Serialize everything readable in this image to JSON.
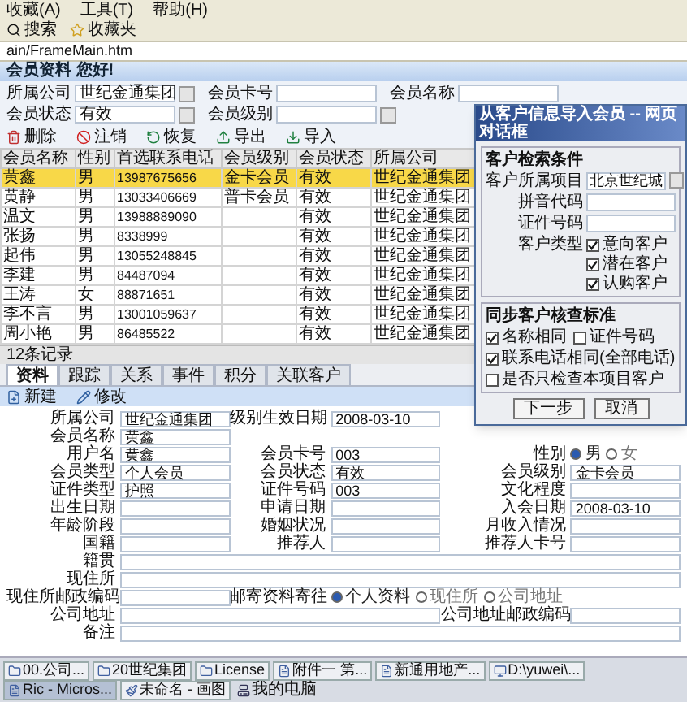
{
  "browser": {
    "menu": [
      "收藏(A)",
      "工具(T)",
      "帮助(H)"
    ],
    "toolbar": [
      "搜索",
      "收藏夹"
    ],
    "address": "ain/FrameMain.htm"
  },
  "header": {
    "title": "会员资料 您好!"
  },
  "search": [
    {
      "label": "所属公司",
      "value": "世纪金通集团",
      "kind": "lookup"
    },
    {
      "label": "会员卡号",
      "kind": "text"
    },
    {
      "label": "会员名称",
      "kind": "text"
    },
    {
      "label": "会员状态",
      "value": "有效",
      "kind": "lookup"
    },
    {
      "label": "会员级别",
      "kind": "lookup"
    }
  ],
  "actions": [
    {
      "label": "删除",
      "kind": "delete"
    },
    {
      "label": "注销",
      "kind": "cancel"
    },
    {
      "label": "恢复",
      "kind": "restore"
    },
    {
      "label": "导出",
      "kind": "export"
    },
    {
      "label": "导入",
      "kind": "import"
    }
  ],
  "table": {
    "columns": [
      "会员名称",
      "性别",
      "首选联系电话",
      "会员级别",
      "会员状态",
      "所属公司"
    ],
    "rows": [
      {
        "cells": [
          "黄鑫",
          "男",
          "13987675656",
          "金卡会员",
          "有效",
          "世纪金通集团"
        ],
        "selected": true
      },
      {
        "cells": [
          "黄静",
          "男",
          "13033406669",
          "普卡会员",
          "有效",
          "世纪金通集团"
        ],
        "selected": false
      },
      {
        "cells": [
          "温文",
          "男",
          "13988889090",
          "",
          "有效",
          "世纪金通集团"
        ],
        "selected": false
      },
      {
        "cells": [
          "张扬",
          "男",
          "8338999",
          "",
          "有效",
          "世纪金通集团"
        ],
        "selected": false
      },
      {
        "cells": [
          "起伟",
          "男",
          "13055248845",
          "",
          "有效",
          "世纪金通集团"
        ],
        "selected": false
      },
      {
        "cells": [
          "李建",
          "男",
          "84487094",
          "",
          "有效",
          "世纪金通集团"
        ],
        "selected": false
      },
      {
        "cells": [
          "王涛",
          "女",
          "88871651",
          "",
          "有效",
          "世纪金通集团"
        ],
        "selected": false
      },
      {
        "cells": [
          "李不言",
          "男",
          "13001059637",
          "",
          "有效",
          "世纪金通集团"
        ],
        "selected": false
      },
      {
        "cells": [
          "周小艳",
          "男",
          "86485522",
          "",
          "有效",
          "世纪金通集团"
        ],
        "selected": false
      }
    ]
  },
  "status": "12条记录",
  "tabs": [
    {
      "label": "资料",
      "selected": true
    },
    {
      "label": "跟踪",
      "selected": false
    },
    {
      "label": "关系",
      "selected": false
    },
    {
      "label": "事件",
      "selected": false
    },
    {
      "label": "积分",
      "selected": false
    },
    {
      "label": "关联客户",
      "selected": false
    }
  ],
  "form_toolbar": [
    {
      "label": "新建",
      "kind": "new"
    },
    {
      "label": "修改",
      "kind": "edit"
    }
  ],
  "form": [
    {
      "left": {
        "label": "所属公司",
        "value": "世纪金通集团"
      },
      "middle": {
        "label": "级别生效日期",
        "value": "2008-03-10"
      }
    },
    {
      "left": {
        "label": "会员名称",
        "value": "黄鑫"
      }
    },
    {
      "left": {
        "label": "用户名",
        "value": "黄鑫"
      },
      "middle": {
        "label": "会员卡号",
        "value": "003"
      },
      "right": {
        "label": "性别",
        "kind": "radio",
        "options": [
          {
            "label": "男",
            "selected": true
          },
          {
            "label": "女",
            "selected": false
          }
        ]
      }
    },
    {
      "left": {
        "label": "会员类型",
        "value": "个人会员"
      },
      "middle": {
        "label": "会员状态",
        "value": "有效"
      },
      "right": {
        "label": "会员级别",
        "value": "金卡会员"
      }
    },
    {
      "left": {
        "label": "证件类型",
        "value": "护照"
      },
      "middle": {
        "label": "证件号码",
        "value": "003"
      },
      "right": {
        "label": "文化程度"
      }
    },
    {
      "left": {
        "label": "出生日期"
      },
      "middle": {
        "label": "申请日期"
      },
      "right": {
        "label": "入会日期",
        "value": "2008-03-10"
      }
    },
    {
      "left": {
        "label": "年龄阶段"
      },
      "middle": {
        "label": "婚姻状况"
      },
      "right": {
        "label": "月收入情况"
      }
    },
    {
      "left": {
        "label": "国籍"
      },
      "middle": {
        "label": "推荐人"
      },
      "right": {
        "label": "推荐人卡号"
      }
    },
    {
      "left": {
        "label": "籍贯",
        "kind": "wide"
      }
    },
    {
      "left": {
        "label": "现住所",
        "kind": "wide"
      }
    },
    {
      "left": {
        "label": "现住所邮政编码"
      },
      "middle": {
        "label": "邮寄资料寄往",
        "kind": "radio",
        "options": [
          {
            "label": "个人资料",
            "selected": true
          },
          {
            "label": "现住所",
            "selected": false
          },
          {
            "label": "公司地址",
            "selected": false
          }
        ]
      }
    },
    {
      "left": {
        "label": "公司地址",
        "kind": "long"
      },
      "right": {
        "label": "公司地址邮政编码"
      }
    },
    {
      "left": {
        "label": "备注",
        "kind": "wide"
      }
    }
  ],
  "dialog": {
    "title": "从客户信息导入会员 -- 网页对话框",
    "criteria": {
      "title": "客户检索条件",
      "fields": [
        {
          "label": "客户所属项目",
          "value": "北京世纪城",
          "kind": "lookup"
        },
        {
          "label": "拼音代码",
          "kind": "text"
        },
        {
          "label": "证件号码",
          "kind": "text"
        },
        {
          "label": "客户类型",
          "kind": "checks",
          "options": [
            {
              "label": "意向客户",
              "checked": true
            },
            {
              "label": "潜在客户",
              "checked": true
            },
            {
              "label": "认购客户",
              "checked": true
            }
          ]
        }
      ]
    },
    "match": {
      "title": "同步客户核查标准",
      "options": [
        {
          "label": "名称相同",
          "checked": true
        },
        {
          "label": "证件号码",
          "checked": false
        },
        {
          "label": "联系电话相同(全部电话)",
          "checked": true
        },
        {
          "label": "是否只检查本项目客户",
          "checked": false
        }
      ]
    },
    "buttons": [
      "下一步",
      "取消"
    ]
  },
  "taskbar": {
    "items": [
      {
        "label": "00.公司...",
        "kind": "folder",
        "selected": false
      },
      {
        "label": "20世纪集团",
        "kind": "folder",
        "selected": false
      },
      {
        "label": "License",
        "kind": "folder",
        "selected": false
      },
      {
        "label": "附件一 第...",
        "kind": "doc",
        "selected": false
      },
      {
        "label": "新通用地产...",
        "kind": "doc",
        "selected": false
      },
      {
        "label": "D:\\yuwei\\...",
        "kind": "window",
        "selected": false
      },
      {
        "label": "Ric - Micros...",
        "kind": "doc",
        "selected": true
      },
      {
        "label": "未命名 - 画图",
        "kind": "paint",
        "selected": false
      }
    ],
    "tray": "我的电脑"
  }
}
